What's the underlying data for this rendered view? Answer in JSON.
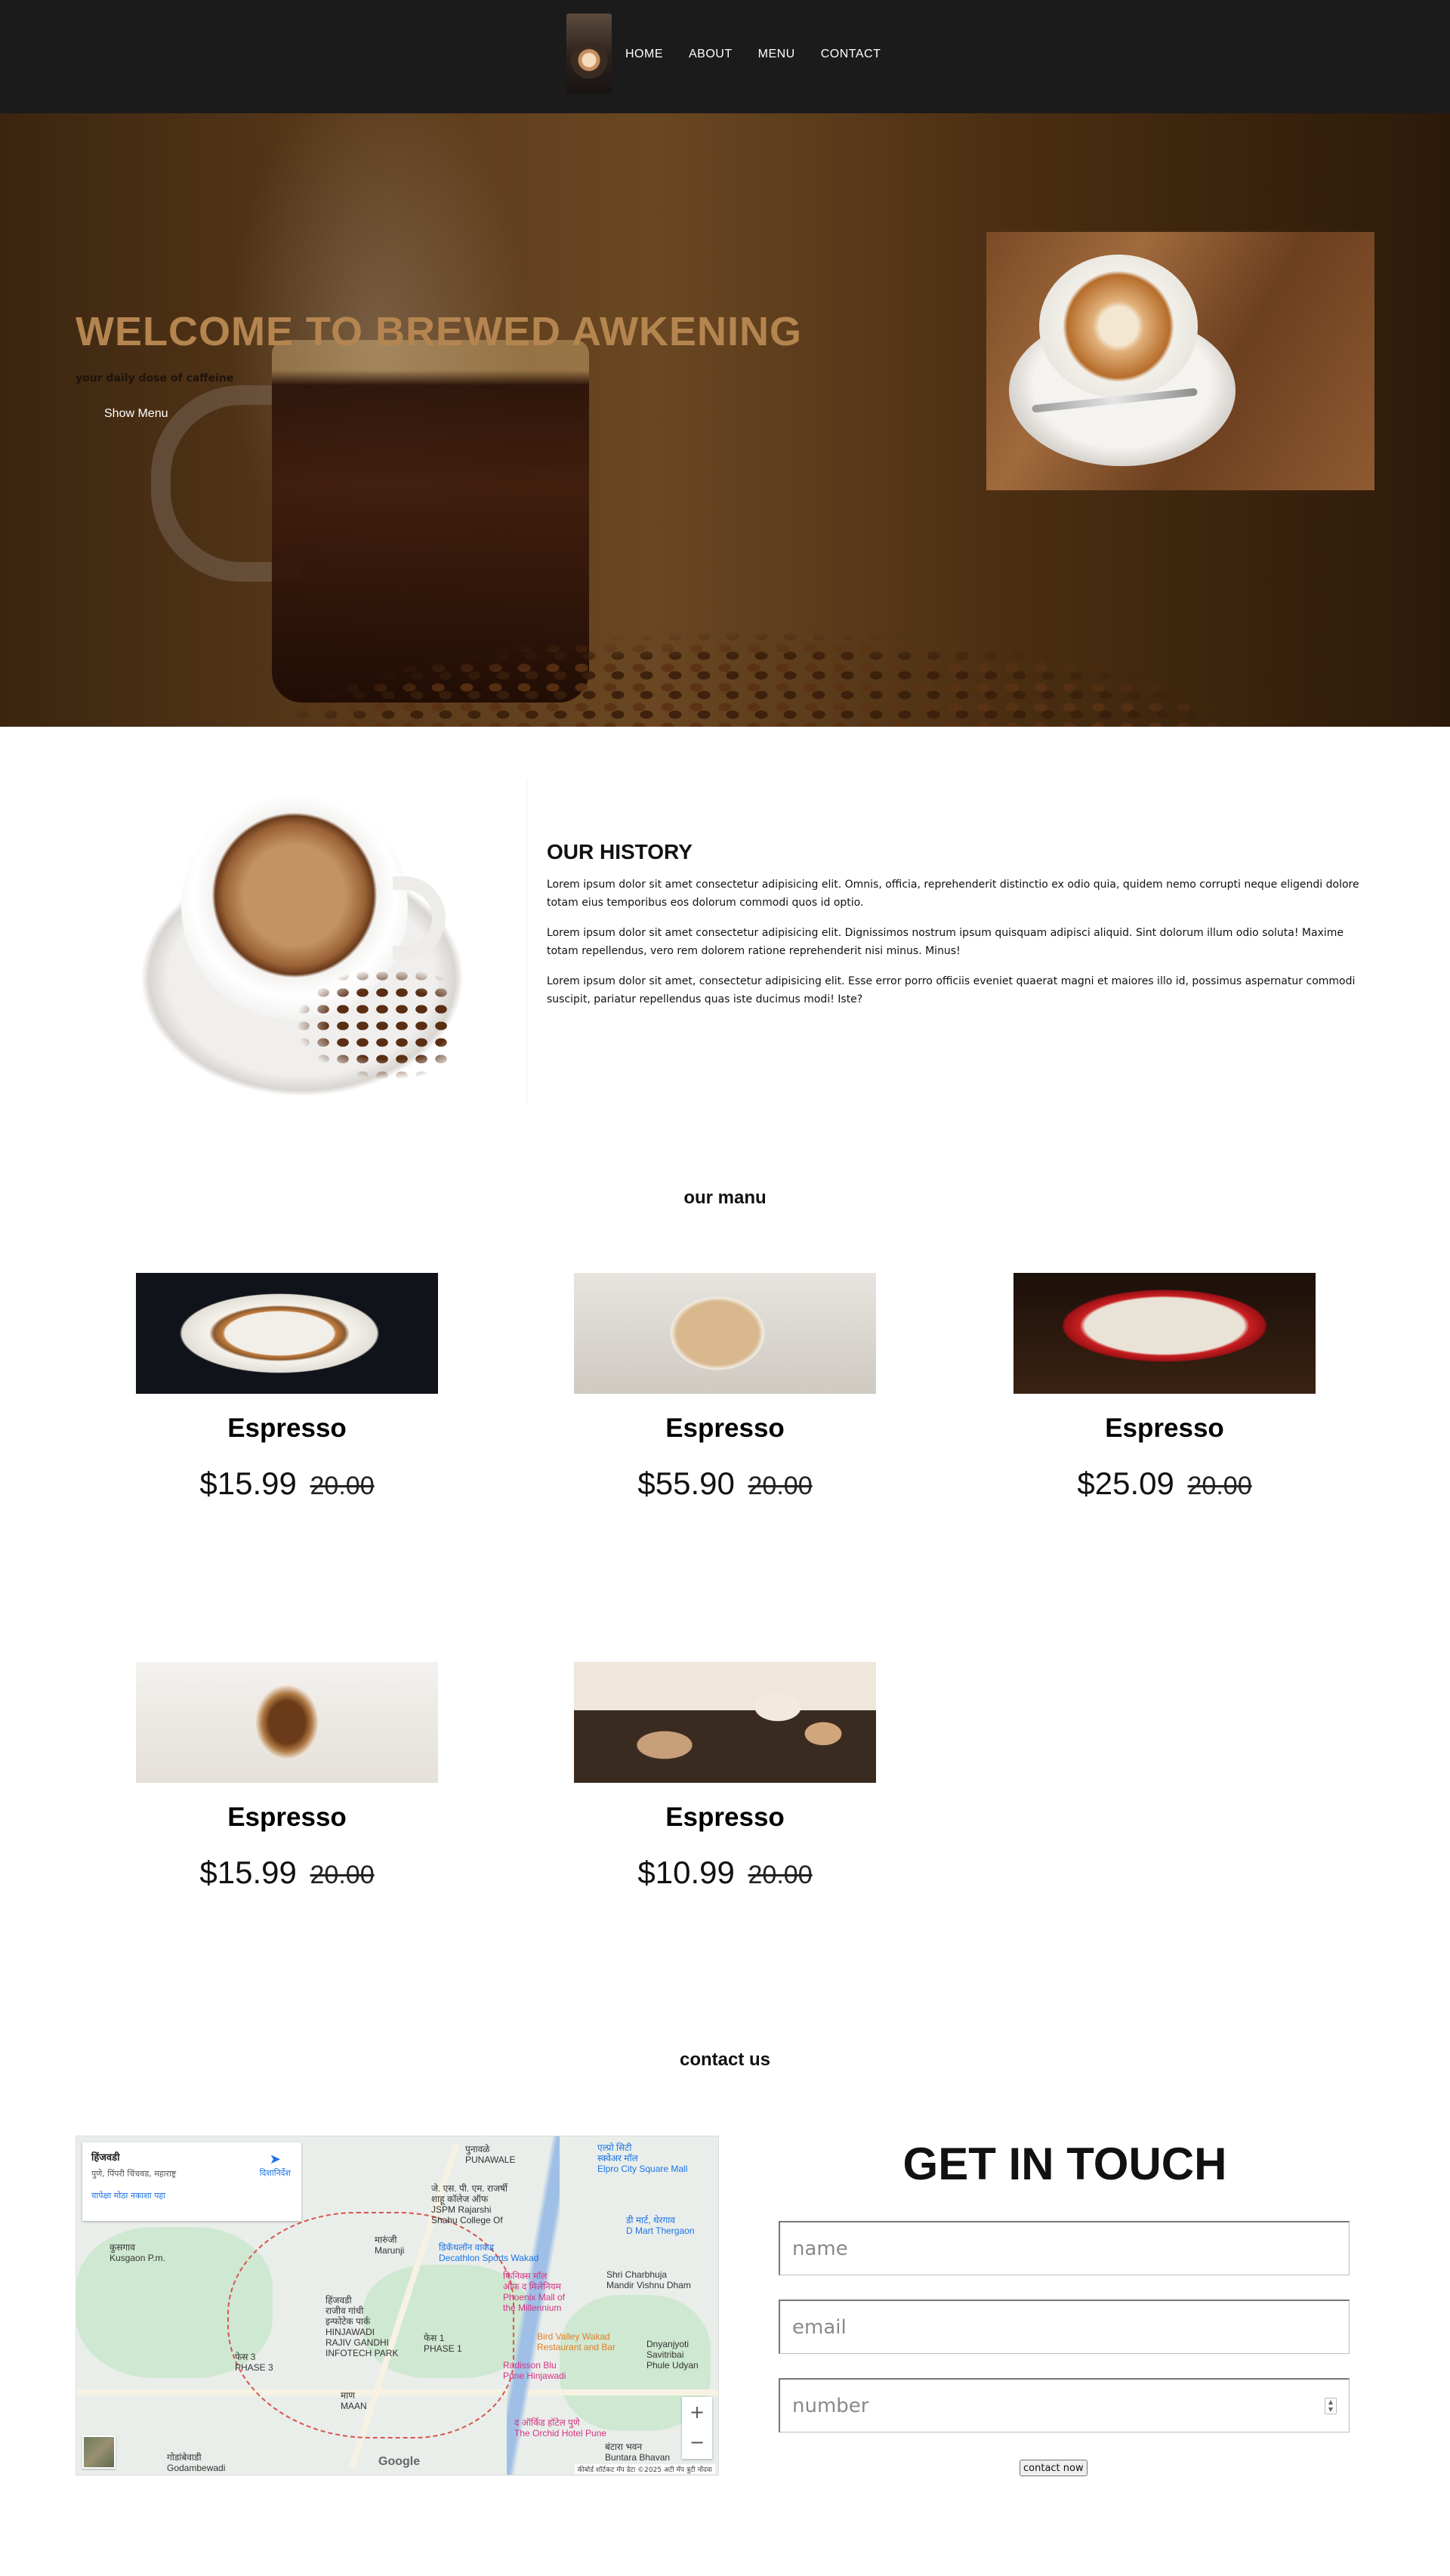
{
  "nav": {
    "logo_alt": "coffee-logo",
    "links": [
      "HOME",
      "ABOUT",
      "MENU",
      "CONTACT"
    ]
  },
  "hero": {
    "title": "WELCOME TO BREWED AWKENING",
    "subtitle": "your daily dose of caffeine",
    "button": "Show Menu",
    "title_color": "#b58550"
  },
  "history": {
    "title": "OUR HISTORY",
    "paragraphs": [
      "Lorem ipsum dolor sit amet consectetur adipisicing elit. Omnis, officia, reprehenderit distinctio ex odio quia, quidem nemo corrupti neque eligendi dolore totam eius temporibus eos dolorum commodi quos id optio.",
      "Lorem ipsum dolor sit amet consectetur adipisicing elit. Dignissimos nostrum ipsum quisquam adipisci aliquid. Sint dolorum illum odio soluta! Maxime totam repellendus, vero rem dolorem ratione reprehenderit nisi minus. Minus!",
      "Lorem ipsum dolor sit amet, consectetur adipisicing elit. Esse error porro officiis eveniet quaerat magni et maiores illo id, possimus aspernatur commodi suscipit, pariatur repellendus quas iste ducimus modi! Iste?"
    ]
  },
  "menu": {
    "heading": "our manu",
    "items": [
      {
        "name": "Espresso",
        "price": "$15.99",
        "old_price": "20.00"
      },
      {
        "name": "Espresso",
        "price": "$55.90",
        "old_price": "20.00"
      },
      {
        "name": "Espresso",
        "price": "$25.09",
        "old_price": "20.00"
      },
      {
        "name": "Espresso",
        "price": "$15.99",
        "old_price": "20.00"
      },
      {
        "name": "Espresso",
        "price": "$10.99",
        "old_price": "20.00"
      }
    ]
  },
  "contact": {
    "heading": "contact us",
    "map": {
      "card_title": "हिंजवडी",
      "card_subtitle": "पुणे, पिंपरी चिंचवड, महाराष्ट्र",
      "card_link": "यापेक्षा मोठा नकाशा पहा",
      "directions": "दिशानिर्देश",
      "labels": {
        "marunji": "मारुंजी\nMarunji",
        "hinjawadi": "हिंजवडी\nराजीव गांधी\nइन्फोटेक पार्क\nHINJAWADI\nRAJIV GANDHI\nINFOTECH PARK",
        "phase1": "फेस 1\nPHASE 1",
        "phase3": "फेस 3\nPHASE 3",
        "kusgaon": "कुसगाव\nKusgaon P.m.",
        "godambewadi": "गोडांबेवाडी\nGodambewadi",
        "decathlon": "डिकॅथलॉन वाकड\nDecathlon Sports Wakad",
        "phoenix": "फिनिक्स मॉल\nऑफ द मिलेनियम\nPhoenix Mall of\nthe Millennium",
        "birdvalley": "Bird Valley Wakad\nRestaurant and Bar",
        "radisson": "Radisson Blu\nPune Hinjawadi",
        "dmart": "डी मार्ट, थेरगाव\nD Mart Thergaon",
        "elpro": "एल्प्रो सिटी\nस्क्वेअर मॉल\nElpro City Square Mall",
        "dnyanjyoti": "Dnyanjyoti\nSavitribai\nPhule Udyan",
        "orchid": "द ऑर्किड हॉटेल पुणे\nThe Orchid Hotel Pune",
        "jspm": "जे. एस. पी. एम. राजर्षी\nशाहू कॉलेज ऑफ\nJSPM Rajarshi\nShahu College Of",
        "shrichar": "Shri Charbhuja\nMandir Vishnu Dham",
        "punawale": "पुनावळे\nPUNAWALE",
        "mann": "माण\nMAAN",
        "bantara": "बंटारा भवन\nBuntara Bhavan"
      },
      "google": "Google",
      "attribution": "कीबोर्ड शॉर्टकट  मॅप डेटा ©2025  अटी  मॅप त्रुटी नोंदवा",
      "zoom_in": "+",
      "zoom_out": "−"
    },
    "form": {
      "title": "GET IN TOUCH",
      "name_placeholder": "name",
      "email_placeholder": "email",
      "number_placeholder": "number",
      "button": "contact now"
    }
  }
}
